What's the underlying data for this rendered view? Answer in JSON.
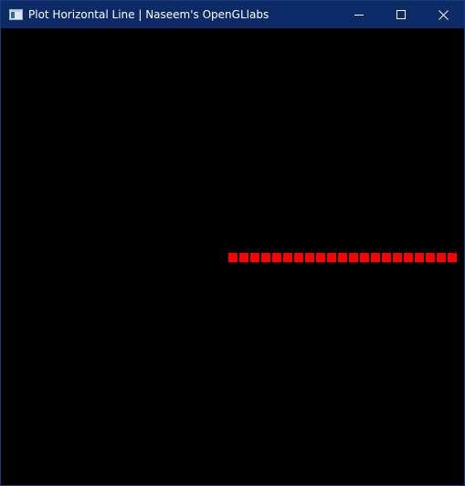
{
  "window": {
    "title": "Plot Horizontal Line | Naseem's OpenGLlabs",
    "controls": {
      "minimize_icon": "minimize-icon",
      "maximize_icon": "maximize-icon",
      "close_icon": "close-icon"
    }
  },
  "canvas": {
    "background": "#000000",
    "line_color": "#ff0000",
    "point_count": 21
  },
  "colors": {
    "titlebar": "#0b2a66",
    "title_text": "#ffffff"
  }
}
